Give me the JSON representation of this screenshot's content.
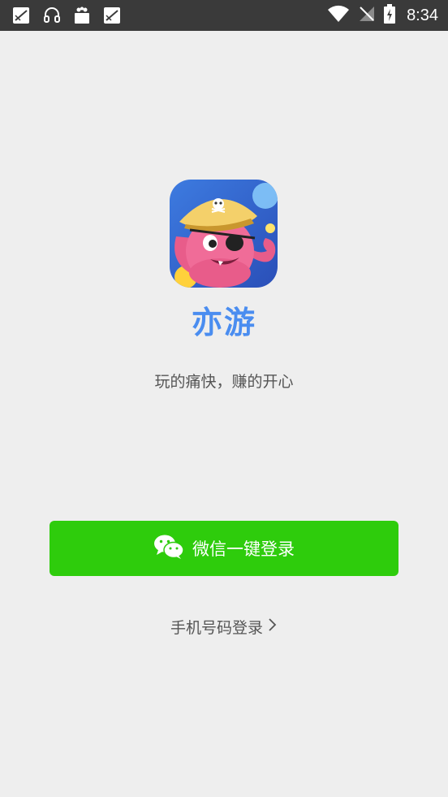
{
  "status_bar": {
    "time": "8:34",
    "left_icons": [
      "image-icon",
      "headset-icon",
      "shopping-bag-icon",
      "image-icon"
    ],
    "right_icons": [
      "wifi-icon",
      "no-signal-icon",
      "battery-charging-icon"
    ]
  },
  "app": {
    "name": "亦游",
    "slogan": "玩的痛快，赚的开心",
    "logo_icon": "pirate-octopus-logo-icon"
  },
  "login": {
    "wechat_label": "微信一键登录",
    "phone_label": "手机号码登录",
    "phone_chevron": "›"
  },
  "colors": {
    "status_bar_bg": "#3a3a3a",
    "page_bg": "#eeeeee",
    "brand_blue": "#4a8df0",
    "wechat_green": "#2ecc0c",
    "text_gray": "#555555"
  }
}
